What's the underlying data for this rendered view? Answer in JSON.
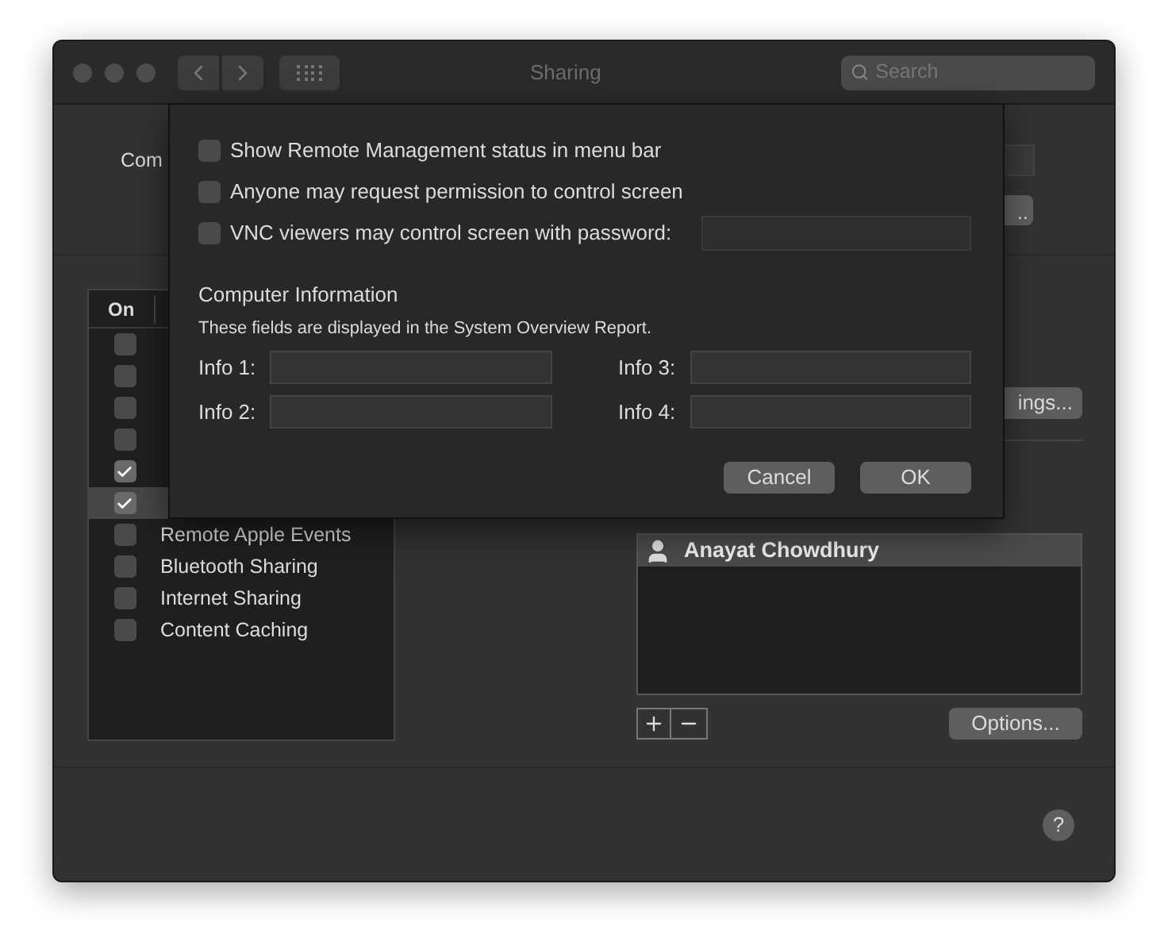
{
  "window": {
    "title": "Sharing",
    "search": {
      "placeholder": "Search"
    }
  },
  "computer_name": {
    "label": "Com",
    "edit_button": ".."
  },
  "services": {
    "columns": [
      "On"
    ],
    "rows": [
      {
        "checked": false,
        "selected": false
      },
      {
        "checked": false,
        "selected": false
      },
      {
        "checked": false,
        "selected": false
      },
      {
        "checked": false,
        "selected": false
      },
      {
        "checked": true,
        "selected": false
      },
      {
        "checked": true,
        "selected": true
      },
      {
        "label": "Remote Apple Events",
        "checked": false,
        "selected": false
      },
      {
        "label": "Bluetooth Sharing",
        "checked": false,
        "selected": false
      },
      {
        "label": "Internet Sharing",
        "checked": false,
        "selected": false
      },
      {
        "label": "Content Caching",
        "checked": false,
        "selected": false
      }
    ]
  },
  "settings_button": "ings...",
  "users": [
    {
      "name": "Anayat Chowdhury",
      "selected": true
    }
  ],
  "options_button": "Options...",
  "help_button": "?",
  "sheet": {
    "options": [
      {
        "kind": "plain",
        "label": "Show Remote Management status in menu bar",
        "checked": false
      },
      {
        "kind": "plain",
        "label": "Anyone may request permission to control screen",
        "checked": false
      },
      {
        "kind": "with_field",
        "label": "VNC viewers may control screen with password:",
        "checked": false
      }
    ],
    "section_title": "Computer Information",
    "description": "These fields are displayed in the System Overview Report.",
    "info_fields": [
      {
        "label": "Info 1:"
      },
      {
        "label": "Info 3:"
      },
      {
        "label": "Info 2:"
      },
      {
        "label": "Info 4:"
      }
    ],
    "buttons": [
      "Cancel",
      "OK"
    ]
  }
}
